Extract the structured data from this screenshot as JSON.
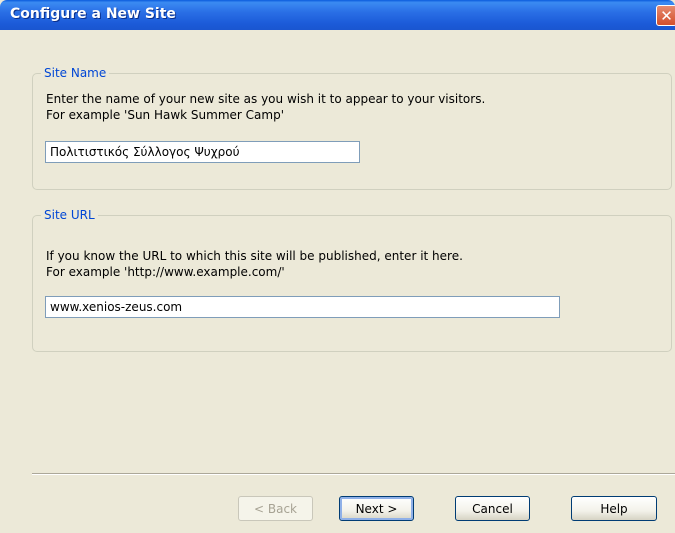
{
  "window": {
    "title": "Configure a New Site"
  },
  "site_name": {
    "legend": "Site Name",
    "instruction": "Enter the name of your new site as you wish it to appear to your visitors.",
    "example": "For example 'Sun Hawk Summer Camp'",
    "value": "Πολιτιστικός Σύλλογος Ψυχρού"
  },
  "site_url": {
    "legend": "Site URL",
    "instruction": "If you know the URL to which this site will be published, enter it here.",
    "example": "For example 'http://www.example.com/'",
    "value": "www.xenios-zeus.com"
  },
  "buttons": {
    "back": "< Back",
    "next": "Next >",
    "cancel": "Cancel",
    "help": "Help"
  },
  "colors": {
    "titlebar": "#1b5ad8",
    "legend": "#0046d5",
    "background": "#ece9d8"
  }
}
